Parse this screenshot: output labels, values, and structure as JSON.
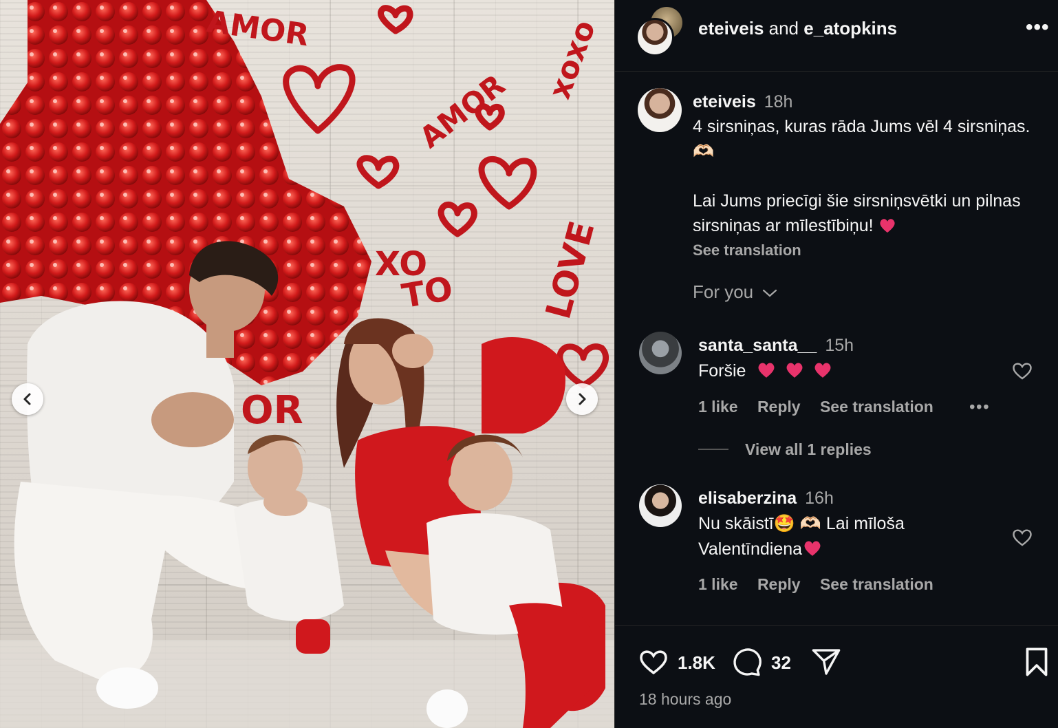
{
  "header": {
    "user1": "eteiveis",
    "and": "and",
    "user2": "e_atopkins"
  },
  "photo_text": {
    "amor1": "AMOR",
    "amor2": "AMOR",
    "xoxo": "xoxo",
    "xo": "XO",
    "to": "TO",
    "love": "LOVE",
    "or": "OR"
  },
  "caption": {
    "username": "eteiveis",
    "time": "18h",
    "line1": "4 sirsniņas, kuras rāda Jums vēl 4 sirsniņas. 🫶🏻",
    "line2": "Lai Jums priecīgi šie sirsniņsvētki un pilnas sirsniņas ar mīlestībiņu!",
    "see_translation": "See translation"
  },
  "filter": {
    "label": "For you"
  },
  "comments": [
    {
      "username": "santa_santa__",
      "time": "15h",
      "text": "Foršie",
      "likes": "1 like",
      "reply": "Reply",
      "see_translation": "See translation",
      "view_replies": "View all 1 replies"
    },
    {
      "username": "elisaberzina",
      "time": "16h",
      "text1": "Nu skāistī🤩 🫶🏻 Lai mīloša",
      "text2": "Valentīndiena",
      "likes": "1 like",
      "reply": "Reply",
      "see_translation": "See translation"
    }
  ],
  "footer": {
    "likes": "1.8K",
    "comments": "32",
    "time_ago": "18 hours ago"
  },
  "colors": {
    "panel_bg": "#0c0f14",
    "heart_emoji": "#e8336b",
    "muted": "#a8a8a8"
  }
}
